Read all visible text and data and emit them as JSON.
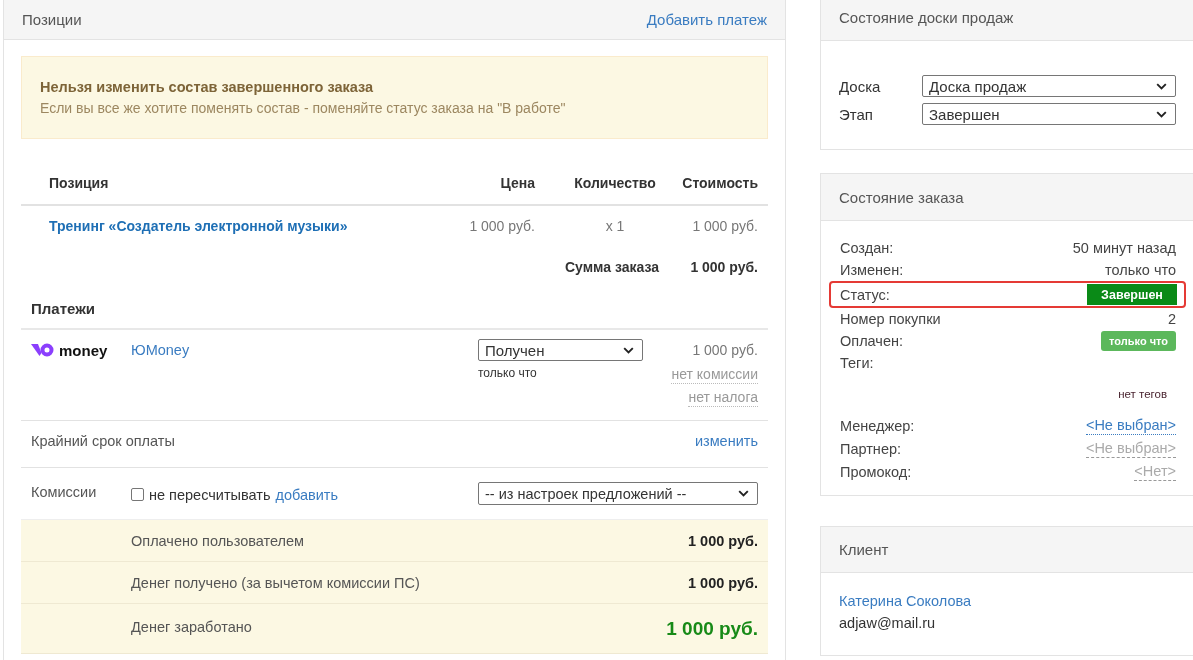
{
  "positions_panel": {
    "title": "Позиции",
    "add_payment_link": "Добавить платеж",
    "notice": {
      "title": "Нельзя изменить состав завершенного заказа",
      "text": "Если вы все же хотите поменять состав - поменяйте статус заказа на \"В работе\""
    },
    "items_table": {
      "columns": [
        "Позиция",
        "Цена",
        "Количество",
        "Стоимость"
      ],
      "rows": [
        {
          "name": "Тренинг «Создатель электронной музыки»",
          "price": "1 000 руб.",
          "quantity": "x 1",
          "cost": "1 000 руб."
        }
      ],
      "total_label": "Сумма заказа",
      "total": "1 000 руб."
    },
    "payments": {
      "title": "Платежи",
      "rows": [
        {
          "logo_text": "money",
          "name": "ЮMoney",
          "status": "Получен",
          "time": "только что",
          "amount": "1 000 руб.",
          "commission": "нет комиссии",
          "tax": "нет налога"
        }
      ]
    },
    "deadline": {
      "label": "Крайний срок оплаты",
      "link": "изменить"
    },
    "commissions": {
      "label": "Комиссии",
      "checkbox": {
        "label": "не пересчитывать",
        "checked": false
      },
      "link": "добавить",
      "select": "-- из настроек предложений --"
    },
    "summary": [
      {
        "label": "Оплачено пользователем",
        "value": "1 000 руб.",
        "kind": "plain"
      },
      {
        "label": "Денег получено (за вычетом комиссии ПС)",
        "value": "1 000 руб.",
        "kind": "plain"
      },
      {
        "label": "Денег заработано",
        "value": "1 000 руб.",
        "kind": "earned"
      }
    ]
  },
  "sales_board_panel": {
    "title": "Состояние доски продаж",
    "fields": [
      {
        "label": "Доска",
        "value": "Доска продаж"
      },
      {
        "label": "Этап",
        "value": "Завершен"
      }
    ]
  },
  "order_status_panel": {
    "title": "Состояние заказа",
    "status_row_highlighted": true,
    "rows": [
      {
        "kind": "text",
        "label": "Создан:",
        "value": "50 минут назад"
      },
      {
        "kind": "text",
        "label": "Изменен:",
        "value": "только что"
      },
      {
        "kind": "status",
        "label": "Статус:",
        "value": "Завершен"
      },
      {
        "kind": "text",
        "label": "Номер покупки",
        "value": "2"
      },
      {
        "kind": "badge",
        "label": "Оплачен:",
        "value": "только что"
      },
      {
        "kind": "tags",
        "label": "Теги:",
        "value": "нет тегов"
      }
    ],
    "assignments": [
      {
        "label": "Менеджер:",
        "value": "<Не выбран>",
        "disabled": false
      },
      {
        "label": "Партнер:",
        "value": "<Не выбран>",
        "disabled": true
      },
      {
        "label": "Промокод:",
        "value": "<Нет>",
        "disabled": true
      }
    ]
  },
  "client_panel": {
    "title": "Клиент",
    "name": "Катерина Соколова",
    "email": "adjaw@mail.ru"
  }
}
